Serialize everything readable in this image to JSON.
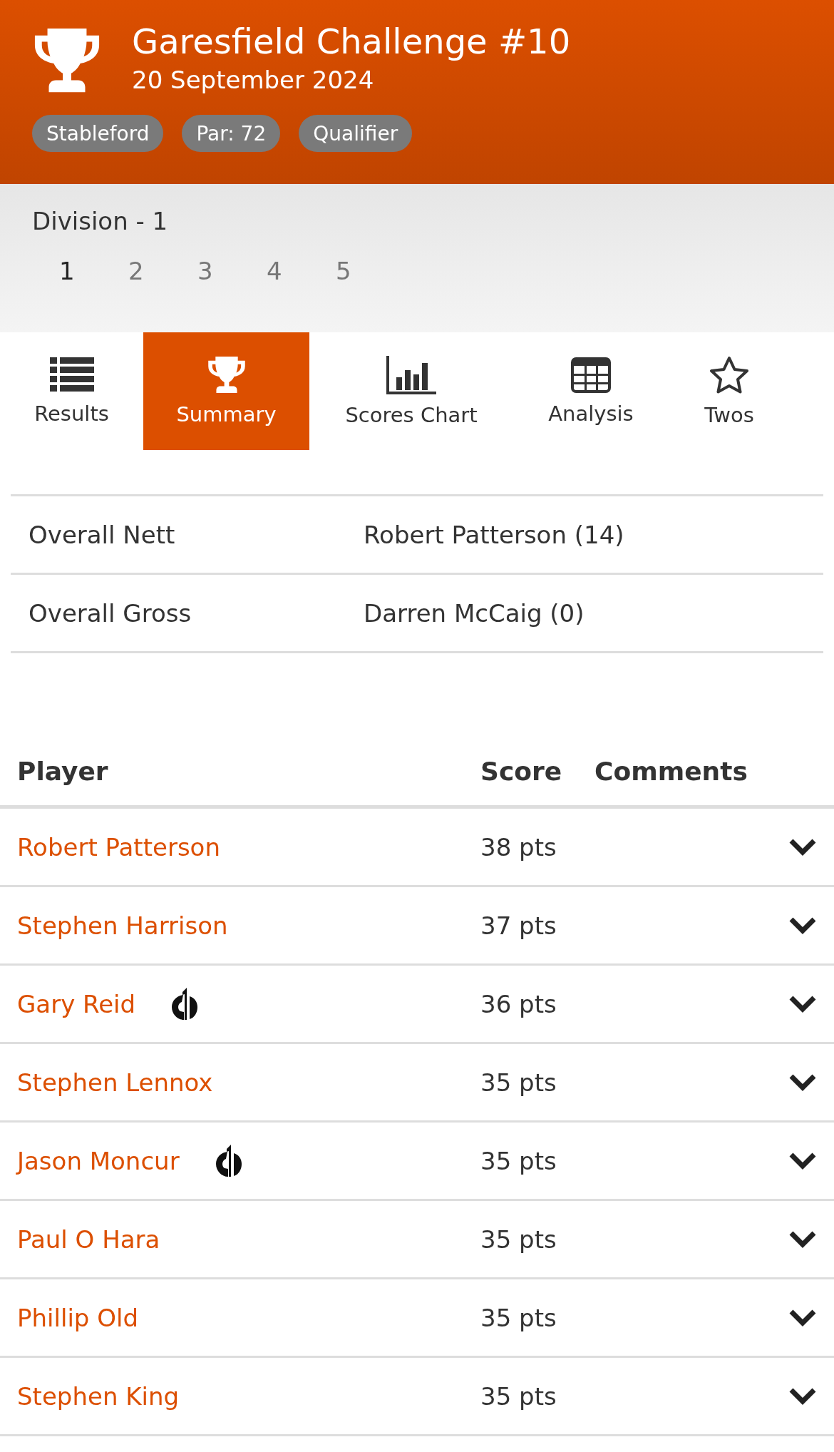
{
  "header": {
    "title": "Garesfield Challenge #10",
    "date": "20 September 2024",
    "tags": [
      "Stableford",
      "Par: 72",
      "Qualifier"
    ]
  },
  "division": {
    "title": "Division - 1",
    "pages": [
      {
        "label": "1",
        "selected": true
      },
      {
        "label": "2",
        "selected": false
      },
      {
        "label": "3",
        "selected": false
      },
      {
        "label": "4",
        "selected": false
      },
      {
        "label": "5",
        "selected": false
      }
    ]
  },
  "tabs": [
    {
      "label": "Results",
      "kind": "list",
      "selected": false
    },
    {
      "label": "Summary",
      "kind": "trophy",
      "selected": true
    },
    {
      "label": "Scores Chart",
      "kind": "chart",
      "selected": false
    },
    {
      "label": "Analysis",
      "kind": "table",
      "selected": false
    },
    {
      "label": "Twos",
      "kind": "star",
      "selected": false
    }
  ],
  "summary": [
    {
      "label": "Overall Nett",
      "winner": "Robert Patterson (14)"
    },
    {
      "label": "Overall Gross",
      "winner": "Darren McCaig (0)"
    }
  ],
  "players": {
    "columns": [
      "Player",
      "Score",
      "Comments"
    ],
    "rows": [
      {
        "name": "Robert Patterson",
        "score": "38 pts",
        "marked": false
      },
      {
        "name": "Stephen Harrison",
        "score": "37 pts",
        "marked": false
      },
      {
        "name": "Gary Reid",
        "score": "36 pts",
        "marked": true
      },
      {
        "name": "Stephen Lennox",
        "score": "35 pts",
        "marked": false
      },
      {
        "name": "Jason Moncur",
        "score": "35 pts",
        "marked": true
      },
      {
        "name": "Paul O Hara",
        "score": "35 pts",
        "marked": false
      },
      {
        "name": "Phillip Old",
        "score": "35 pts",
        "marked": false
      },
      {
        "name": "Stephen King",
        "score": "35 pts",
        "marked": false
      }
    ]
  }
}
